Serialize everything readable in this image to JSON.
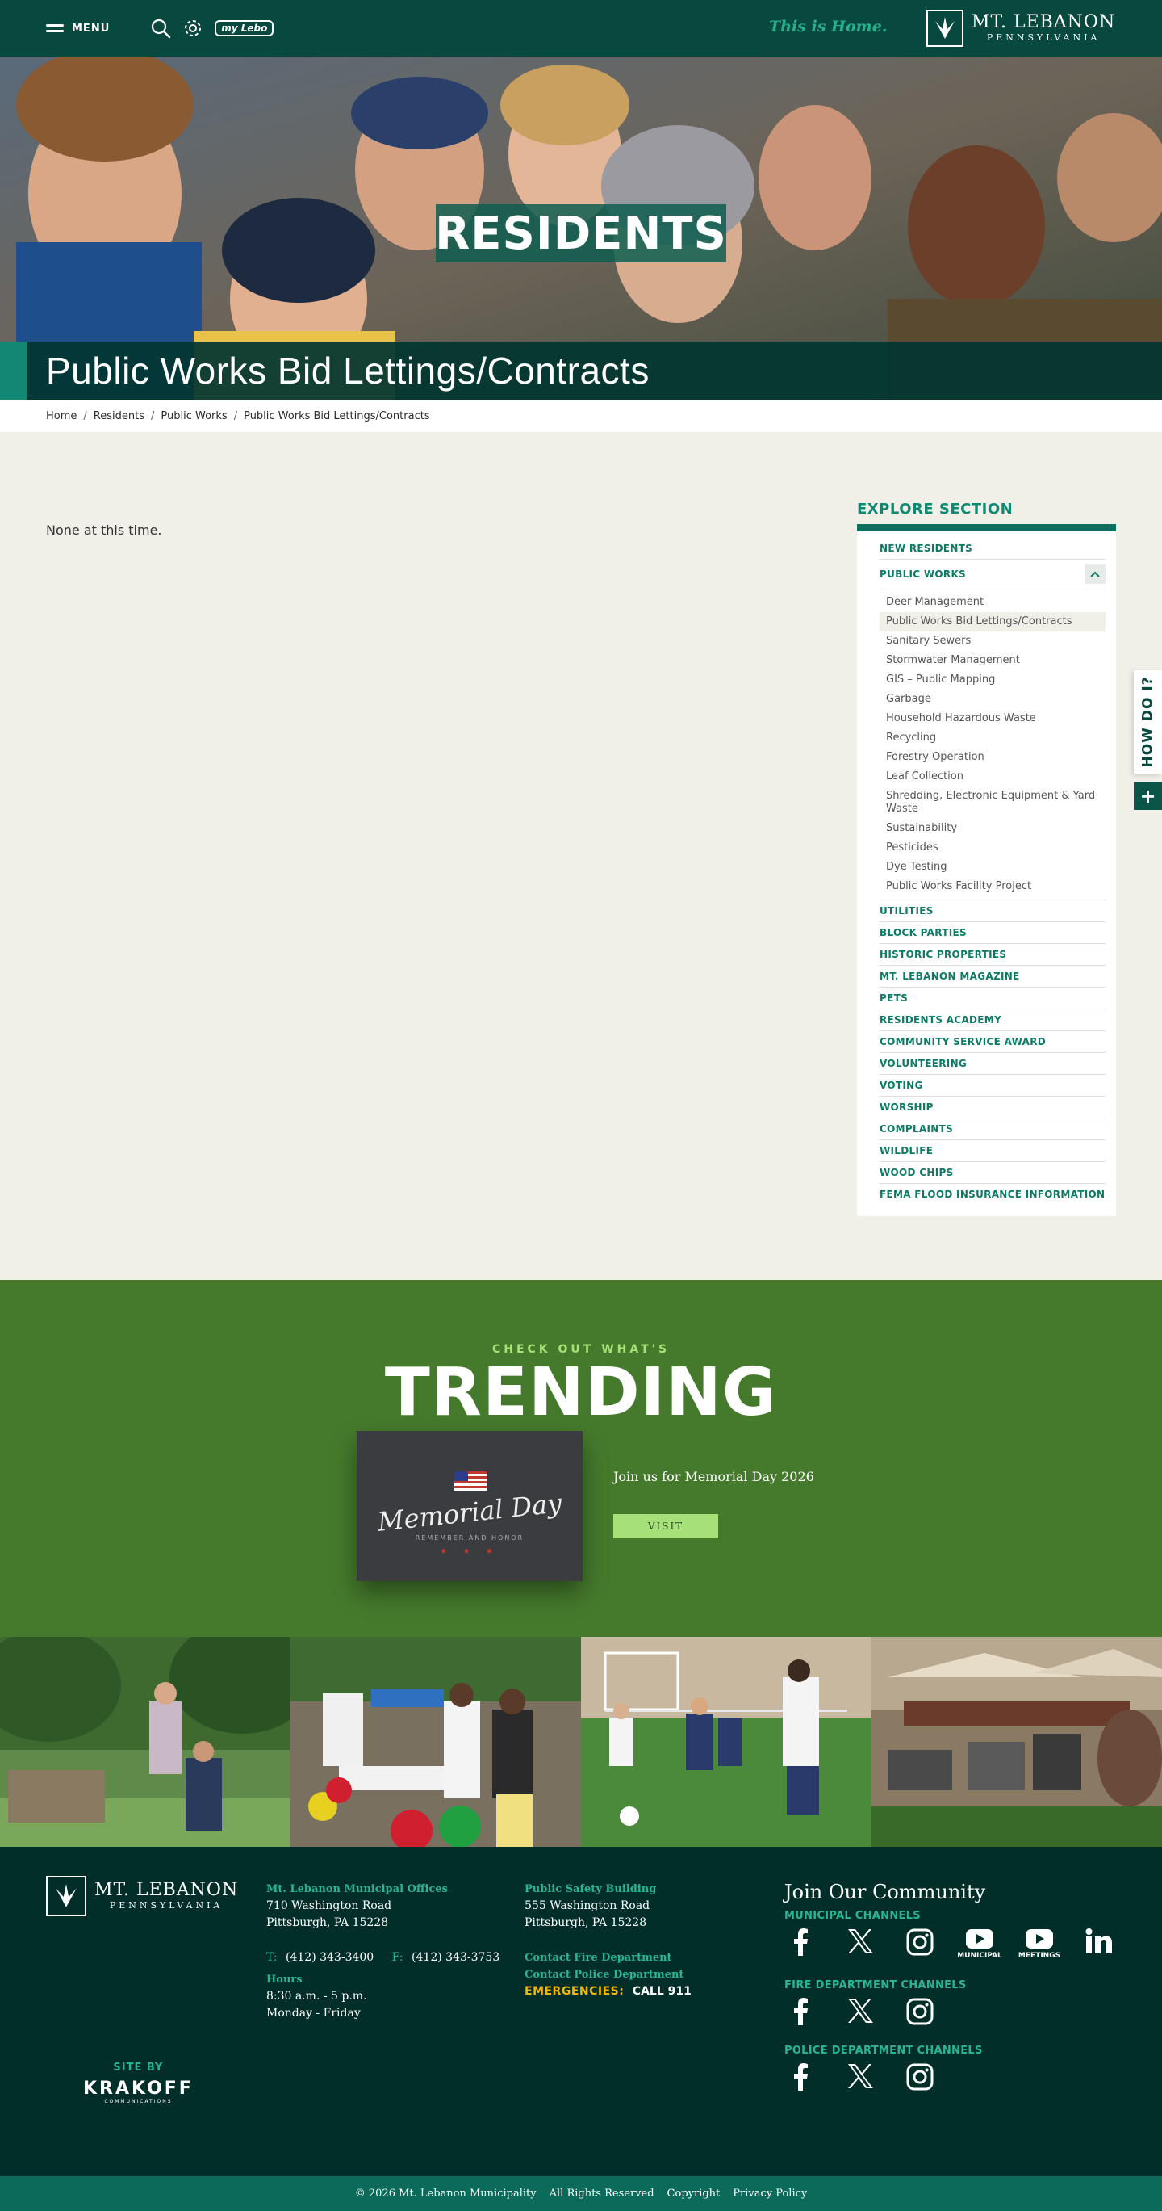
{
  "header": {
    "menu_label": "MENU",
    "mylebo_label": "my Lebo",
    "tagline": "This is Home.",
    "logo_line1": "MT. LEBANON",
    "logo_line2": "PENNSYLVANIA"
  },
  "hero": {
    "section_title": "RESIDENTS",
    "page_title": "Public Works Bid Lettings/Contracts"
  },
  "breadcrumb": [
    "Home",
    "Residents",
    "Public Works",
    "Public Works Bid Lettings/Contracts"
  ],
  "main": {
    "content_text": "None at this time."
  },
  "sidebar": {
    "title": "EXPLORE SECTION",
    "items_before": [
      "NEW RESIDENTS"
    ],
    "expanded_item": "PUBLIC WORKS",
    "sub_items": [
      "Deer Management",
      "Public Works Bid Lettings/Contracts",
      "Sanitary Sewers",
      "Stormwater Management",
      "GIS – Public Mapping",
      "Garbage",
      "Household Hazardous Waste",
      "Recycling",
      "Forestry Operation",
      "Leaf Collection",
      "Shredding, Electronic Equipment & Yard Waste",
      "Sustainability",
      "Pesticides",
      "Dye Testing",
      "Public Works Facility Project"
    ],
    "active_sub_item": "Public Works Bid Lettings/Contracts",
    "items_after": [
      "UTILITIES",
      "BLOCK PARTIES",
      "HISTORIC PROPERTIES",
      "MT. LEBANON MAGAZINE",
      "PETS",
      "RESIDENTS ACADEMY",
      "COMMUNITY SERVICE AWARD",
      "VOLUNTEERING",
      "VOTING",
      "WORSHIP",
      "COMPLAINTS",
      "WILDLIFE",
      "WOOD CHIPS",
      "FEMA FLOOD INSURANCE INFORMATION"
    ]
  },
  "howdo": {
    "label": "HOW DO I?",
    "plus": "+"
  },
  "trending": {
    "eyebrow": "CHECK OUT WHAT'S",
    "title": "TRENDING",
    "card_script": "Memorial Day",
    "card_sub": "REMEMBER AND HONOR",
    "card_stars": "★ ★ ★",
    "text": "Join us for Memorial Day 2026",
    "button": "VISIT"
  },
  "footer": {
    "logo_line1": "MT. LEBANON",
    "logo_line2": "PENNSYLVANIA",
    "municipal": {
      "heading": "Mt. Lebanon Municipal Offices",
      "address1": "710 Washington Road",
      "address2": "Pittsburgh, PA 15228",
      "t_label": "T:",
      "phone": "(412) 343-3400",
      "f_label": "F:",
      "fax": "(412) 343-3753",
      "hours_label": "Hours",
      "hours1": "8:30 a.m. - 5 p.m.",
      "hours2": "Monday - Friday"
    },
    "safety": {
      "heading": "Public Safety Building",
      "address1": "555 Washington Road",
      "address2": "Pittsburgh, PA 15228",
      "fire_link": "Contact Fire Department",
      "police_link": "Contact Police Department",
      "emergency_label": "EMERGENCIES:",
      "emergency_value": "CALL 911"
    },
    "community": {
      "title": "Join Our Community",
      "municipal_channels": "MUNICIPAL CHANNELS",
      "fire_channels": "FIRE DEPARTMENT CHANNELS",
      "police_channels": "POLICE DEPARTMENT CHANNELS",
      "youtube1_caption": "MUNICIPAL",
      "youtube2_caption": "MEETINGS"
    },
    "siteby": {
      "label": "SITE BY",
      "name": "KRAKOFF",
      "sub": "COMMUNICATIONS"
    }
  },
  "bottom_bar": {
    "copyright": "© 2026 Mt. Lebanon Municipality",
    "rights": "All Rights Reserved",
    "copyright_link": "Copyright",
    "privacy": "Privacy Policy"
  },
  "colors": {
    "header_green": "#07493f",
    "accent_teal": "#0e8a72",
    "trending_green": "#457a2c",
    "visit_button": "#a6e078",
    "footer_dark": "#022e29",
    "emergency_yellow": "#f2b705"
  }
}
